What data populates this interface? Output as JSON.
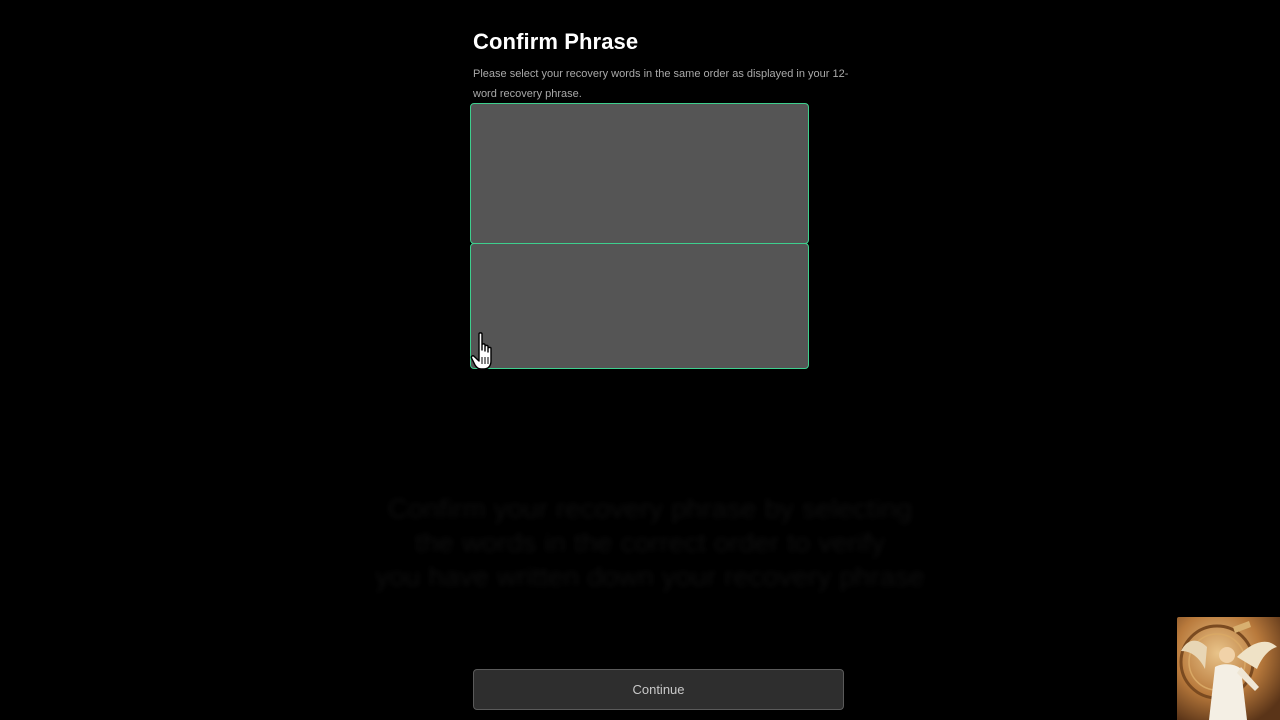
{
  "header": {
    "title": "Confirm Phrase",
    "subtitle": "Please select your recovery words in the same order as displayed in your 12-word recovery phrase."
  },
  "phrase_area": {
    "selected_words": [],
    "available_words": []
  },
  "overlay": {
    "lines": [
      "Confirm your recovery phrase by selecting",
      "the words in the correct order to verify",
      "you have written down your recovery phrase"
    ]
  },
  "footer": {
    "continue_label": "Continue"
  },
  "colors": {
    "background": "#000000",
    "box_fill": "#555555",
    "box_border": "#3ecf8e",
    "button_fill": "#2e2e2e"
  },
  "icons": {
    "cursor": "hand-pointer-icon",
    "thumbnail": "angel-artwork"
  }
}
